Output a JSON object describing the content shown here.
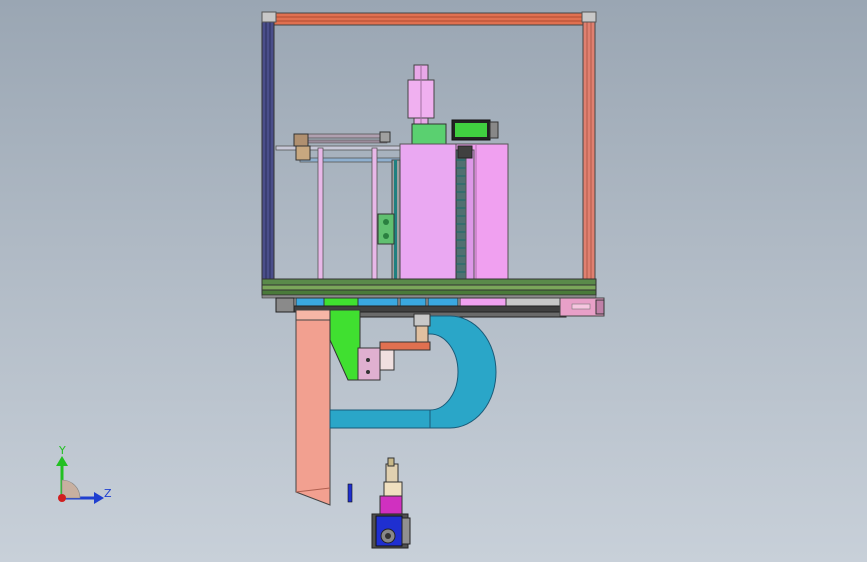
{
  "view": {
    "background_top": "#9aa6b3",
    "background_bottom": "#c8d0d9"
  },
  "triad": {
    "y_label": "Y",
    "z_label": "Z",
    "y_color": "#22c022",
    "z_color": "#1f3fd0",
    "x_color": "#d01f1f"
  },
  "colors": {
    "frame_top": "#e07050",
    "frame_left": "#4a4e8a",
    "frame_right": "#e08070",
    "housing": "#f0a0f0",
    "base_plate": "#5a8a4a",
    "blue_bar": "#3aa8e0",
    "hose": "#2aa6c8",
    "chute": "#f2a090",
    "bracket_green": "#40e030",
    "lcd_green": "#40d040",
    "slider": "#e8a0c8",
    "motor_blue": "#1f2fd0",
    "motor_magenta": "#d030c0"
  }
}
